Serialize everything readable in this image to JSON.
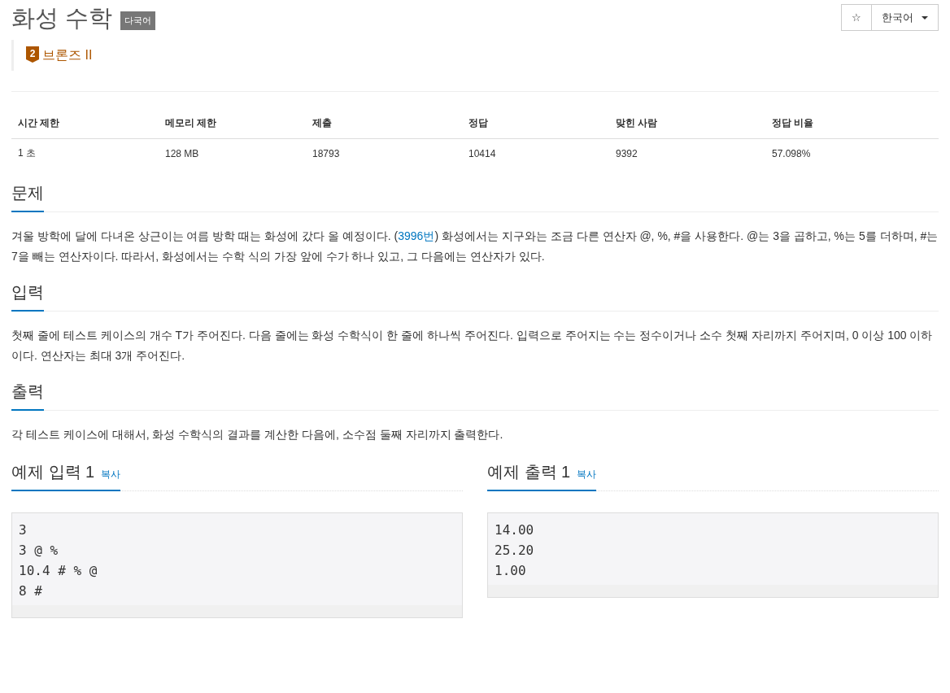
{
  "title": "화성 수학",
  "title_badge": "다국어",
  "toolbar": {
    "star": "☆",
    "language": "한국어"
  },
  "tier": {
    "level": "2",
    "label": "브론즈 II"
  },
  "stats": {
    "columns": [
      "시간 제한",
      "메모리 제한",
      "제출",
      "정답",
      "맞힌 사람",
      "정답 비율"
    ],
    "rows": [
      [
        "1 초",
        "128 MB",
        "18793",
        "10414",
        "9392",
        "57.098%"
      ]
    ]
  },
  "sections": [
    {
      "heading": "문제",
      "text_before": "겨울 방학에 달에 다녀온 상근이는 여름 방학 때는 화성에 갔다 올 예정이다. (",
      "link": "3996번",
      "text_after": ") 화성에서는 지구와는 조금 다른 연산자 @, %, #을 사용한다. @는 3을 곱하고, %는 5를 더하며, #는 7을 빼는 연산자이다. 따라서, 화성에서는 수학 식의 가장 앞에 수가 하나 있고, 그 다음에는 연산자가 있다."
    },
    {
      "heading": "입력",
      "text_before": "첫째 줄에 테스트 케이스의 개수 T가 주어진다. 다음 줄에는 화성 수학식이 한 줄에 하나씩 주어진다. 입력으로 주어지는 수는 정수이거나 소수 첫째 자리까지 주어지며, 0 이상 100 이하이다. 연산자는 최대 3개 주어진다."
    },
    {
      "heading": "출력",
      "text_before": "각 테스트 케이스에 대해서, 화성 수학식의 결과를 계산한 다음에, 소수점 둘째 자리까지 출력한다."
    }
  ],
  "samples": [
    {
      "heading": "예제 입력 1",
      "copy": "복사",
      "lines": [
        "3",
        "3 @ %",
        "10.4 # % @",
        "8 #"
      ]
    },
    {
      "heading": "예제 출력 1",
      "copy": "복사",
      "lines": [
        "14.00",
        "25.20",
        "1.00"
      ]
    }
  ]
}
